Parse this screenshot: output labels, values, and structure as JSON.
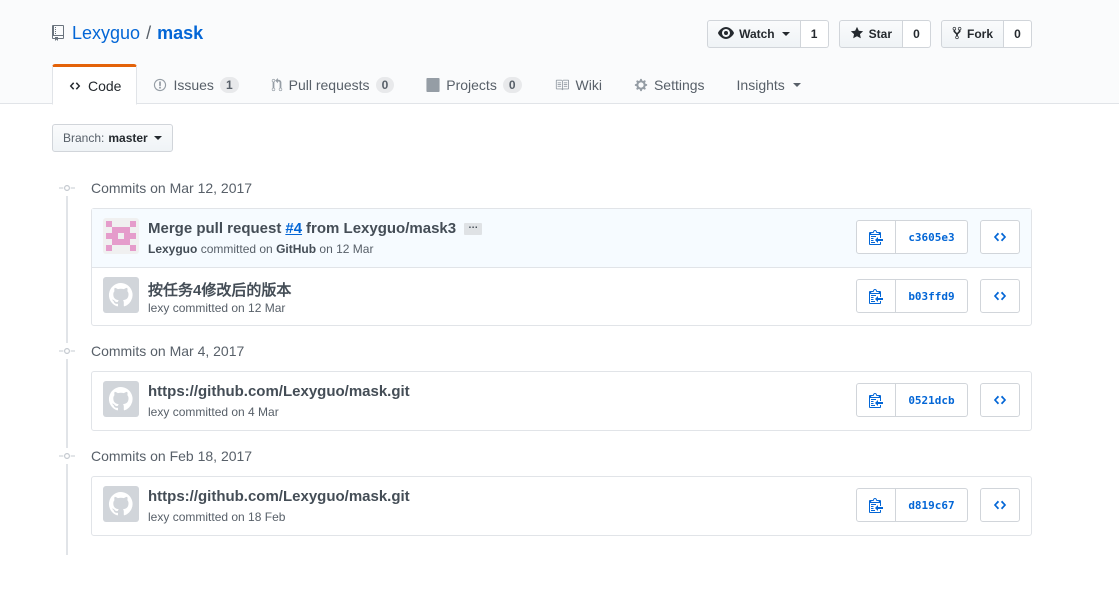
{
  "repo": {
    "owner": "Lexyguo",
    "separator": "/",
    "name": "mask"
  },
  "actions": {
    "watch": {
      "label": "Watch",
      "count": "1"
    },
    "star": {
      "label": "Star",
      "count": "0"
    },
    "fork": {
      "label": "Fork",
      "count": "0"
    }
  },
  "tabs": [
    {
      "label": "Code",
      "icon": "code-icon",
      "selected": true
    },
    {
      "label": "Issues",
      "icon": "issue-icon",
      "counter": "1"
    },
    {
      "label": "Pull requests",
      "icon": "pull-request-icon",
      "counter": "0"
    },
    {
      "label": "Projects",
      "icon": "project-icon",
      "counter": "0"
    },
    {
      "label": "Wiki",
      "icon": "book-icon"
    },
    {
      "label": "Settings",
      "icon": "gear-icon"
    },
    {
      "label": "Insights",
      "icon": "chevron-down-icon"
    }
  ],
  "branch": {
    "prefix": "Branch:",
    "name": "master"
  },
  "groups": [
    {
      "label": "Commits on Mar 12, 2017",
      "commits": [
        {
          "title_prefix": "Merge pull request",
          "pr": "#4",
          "title_suffix": "from Lexyguo/mask3",
          "ellipsis": "…",
          "author": "Lexyguo",
          "committed": "committed on",
          "via": "GitHub",
          "date_text": "on 12 Mar",
          "sha": "c3605e3",
          "avatar": "pixel"
        },
        {
          "title": "按任务4修改后的版本",
          "author": "lexy",
          "meta": "committed on 12 Mar",
          "sha": "b03ffd9",
          "avatar": "octocat"
        }
      ]
    },
    {
      "label": "Commits on Mar 4, 2017",
      "commits": [
        {
          "title": "https://github.com/Lexyguo/mask.git",
          "author": "lexy",
          "meta": "committed on 4 Mar",
          "sha": "0521dcb",
          "avatar": "octocat"
        }
      ]
    },
    {
      "label": "Commits on Feb 18, 2017",
      "commits": [
        {
          "title": "https://github.com/Lexyguo/mask.git",
          "author": "lexy",
          "meta": "committed on 18 Feb",
          "sha": "d819c67",
          "avatar": "octocat"
        }
      ]
    }
  ],
  "colors": {
    "link": "#0366d6",
    "tab_accent": "#e36209",
    "avatar_pixel": "#e59ccb"
  }
}
